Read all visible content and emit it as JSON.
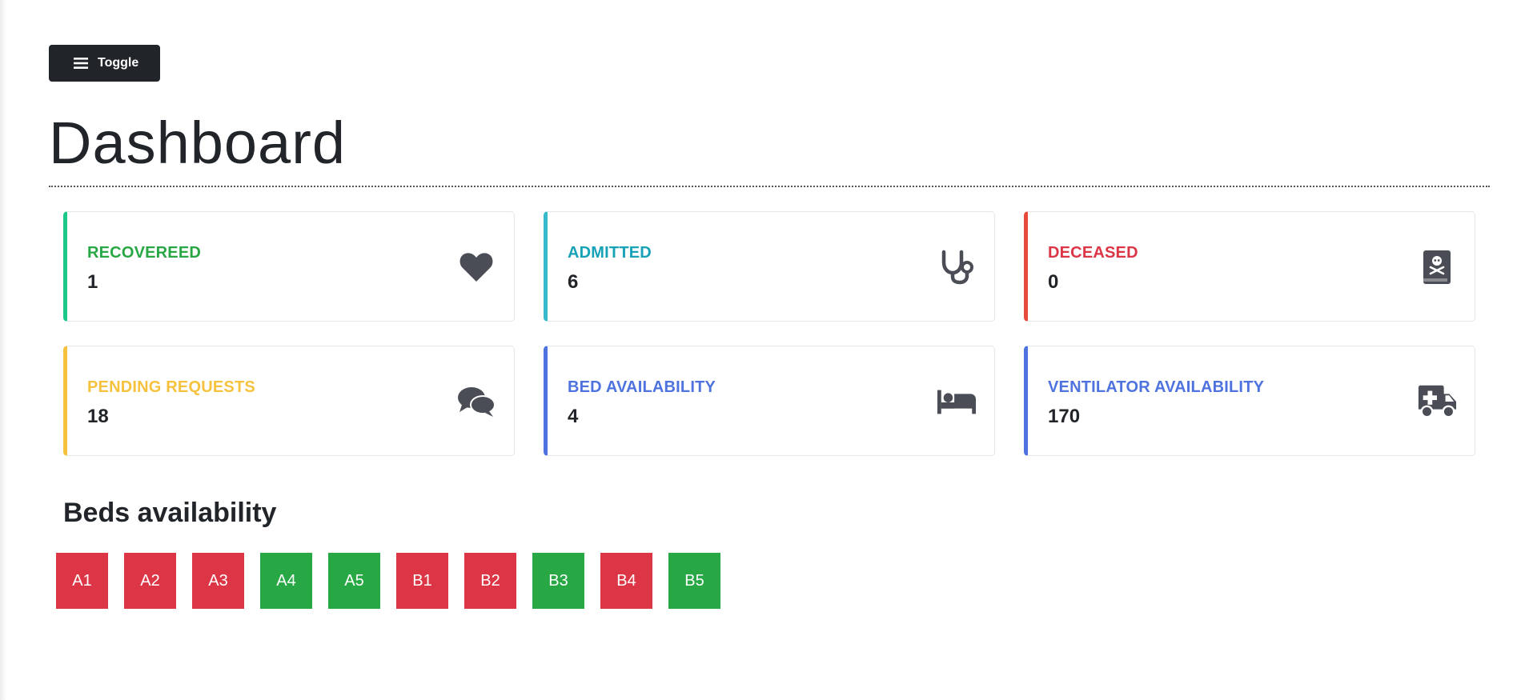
{
  "header": {
    "toggle_label": "Toggle"
  },
  "page": {
    "title": "Dashboard"
  },
  "colors": {
    "success": "#28a745",
    "info": "#17a2b8",
    "danger": "#dc3545",
    "warning": "#ffc107",
    "primary": "#4e73df",
    "icon": "#4a4d55"
  },
  "stats": [
    {
      "label": "RECOVEREED",
      "value": "1",
      "color": "#28a745",
      "border": "#1cc88a",
      "icon": "heart-icon"
    },
    {
      "label": "ADMITTED",
      "value": "6",
      "color": "#17a2b8",
      "border": "#36b9cc",
      "icon": "stethoscope-icon"
    },
    {
      "label": "DECEASED",
      "value": "0",
      "color": "#dc3545",
      "border": "#e74a3b",
      "icon": "skull-book-icon"
    },
    {
      "label": "PENDING REQUESTS",
      "value": "18",
      "color": "#f6c23e",
      "border": "#f6c23e",
      "icon": "comments-icon"
    },
    {
      "label": "BED AVAILABILITY",
      "value": "4",
      "color": "#4e73df",
      "border": "#4e73df",
      "icon": "bed-icon"
    },
    {
      "label": "VENTILATOR AVAILABILITY",
      "value": "170",
      "color": "#4e73df",
      "border": "#4e73df",
      "icon": "ambulance-icon"
    }
  ],
  "beds_section": {
    "heading": "Beds availability",
    "beds": [
      {
        "label": "A1",
        "status": "occupied"
      },
      {
        "label": "A2",
        "status": "occupied"
      },
      {
        "label": "A3",
        "status": "occupied"
      },
      {
        "label": "A4",
        "status": "available"
      },
      {
        "label": "A5",
        "status": "available"
      },
      {
        "label": "B1",
        "status": "occupied"
      },
      {
        "label": "B2",
        "status": "occupied"
      },
      {
        "label": "B3",
        "status": "available"
      },
      {
        "label": "B4",
        "status": "occupied"
      },
      {
        "label": "B5",
        "status": "available"
      }
    ]
  }
}
